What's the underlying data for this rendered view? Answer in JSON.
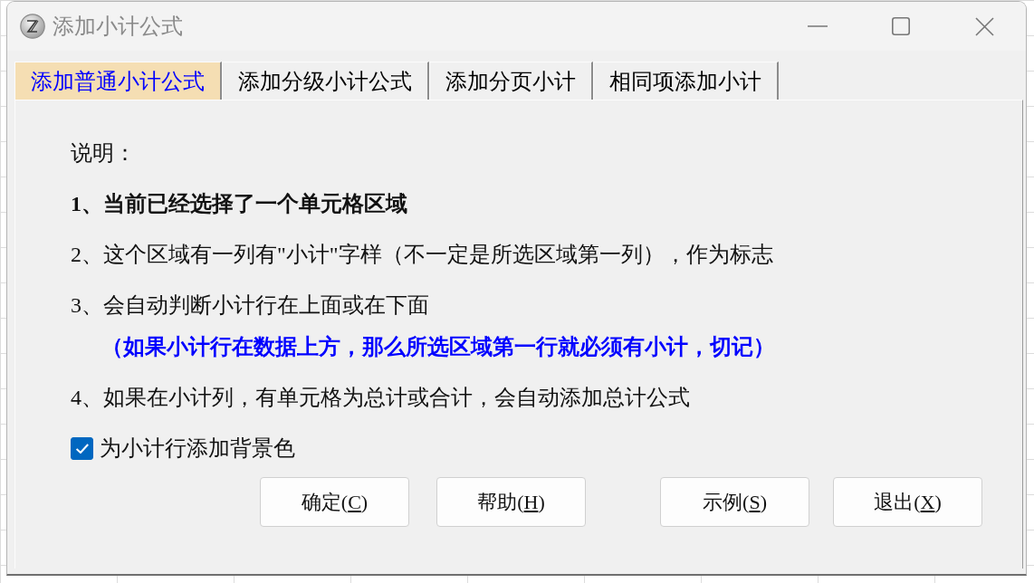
{
  "window": {
    "title": "添加小计公式"
  },
  "tabs": [
    {
      "label": "添加普通小计公式",
      "selected": true
    },
    {
      "label": "添加分级小计公式",
      "selected": false
    },
    {
      "label": "添加分页小计",
      "selected": false
    },
    {
      "label": "相同项添加小计",
      "selected": false
    }
  ],
  "instructions": {
    "heading": "说明：",
    "items": [
      {
        "kind": "bold",
        "text": "1、当前已经选择了一个单元格区域"
      },
      {
        "kind": "plain",
        "text": "2、这个区域有一列有\"小计\"字样（不一定是所选区域第一列），作为标志"
      },
      {
        "kind": "plain",
        "text": "3、会自动判断小计行在上面或在下面"
      },
      {
        "kind": "note",
        "text": "（如果小计行在数据上方，那么所选区域第一行就必须有小计，切记）"
      },
      {
        "kind": "plain",
        "text": "4、如果在小计列，有单元格为总计或合计，会自动添加总计公式"
      }
    ]
  },
  "checkbox": {
    "label": "为小计行添加背景色",
    "checked": true
  },
  "buttons": [
    {
      "text_before": "确定(",
      "access_key": "C",
      "text_after": ")"
    },
    {
      "text_before": "帮助(",
      "access_key": "H",
      "text_after": ")"
    },
    {
      "text_before": "示例(",
      "access_key": "S",
      "text_after": ")"
    },
    {
      "text_before": "退出(",
      "access_key": "X",
      "text_after": ")"
    }
  ]
}
